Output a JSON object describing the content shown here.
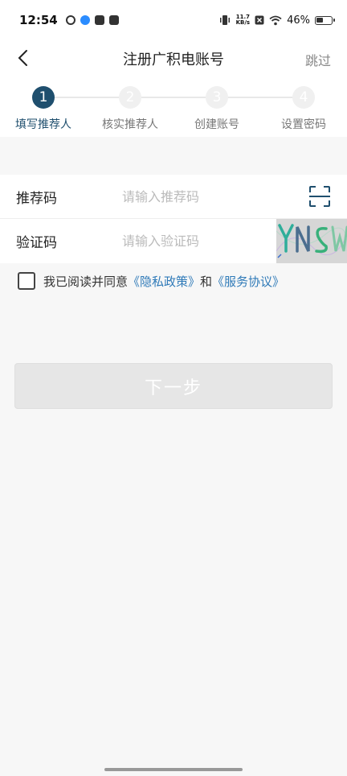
{
  "status_bar": {
    "time": "12:54",
    "net_speed_value": "11.7",
    "net_speed_unit": "KB/s",
    "battery": "46%"
  },
  "header": {
    "title": "注册广积电账号",
    "skip_label": "跳过"
  },
  "steps": [
    {
      "number": "1",
      "label": "填写推荐人",
      "active": true
    },
    {
      "number": "2",
      "label": "核实推荐人",
      "active": false
    },
    {
      "number": "3",
      "label": "创建账号",
      "active": false
    },
    {
      "number": "4",
      "label": "设置密码",
      "active": false
    }
  ],
  "form": {
    "referral_label": "推荐码",
    "referral_placeholder": "请输入推荐码",
    "referral_value": "",
    "captcha_label": "验证码",
    "captcha_placeholder": "请输入验证码",
    "captcha_value": ""
  },
  "agreement": {
    "prefix": "我已阅读并同意",
    "privacy_link": "《隐私政策》",
    "conjunction": "和",
    "service_link": "《服务协议》",
    "checked": false
  },
  "next_button_label": "下一步",
  "colors": {
    "accent": "#1f4f6e",
    "link": "#2f7ab8",
    "disabled_button": "#e6e6e6"
  }
}
